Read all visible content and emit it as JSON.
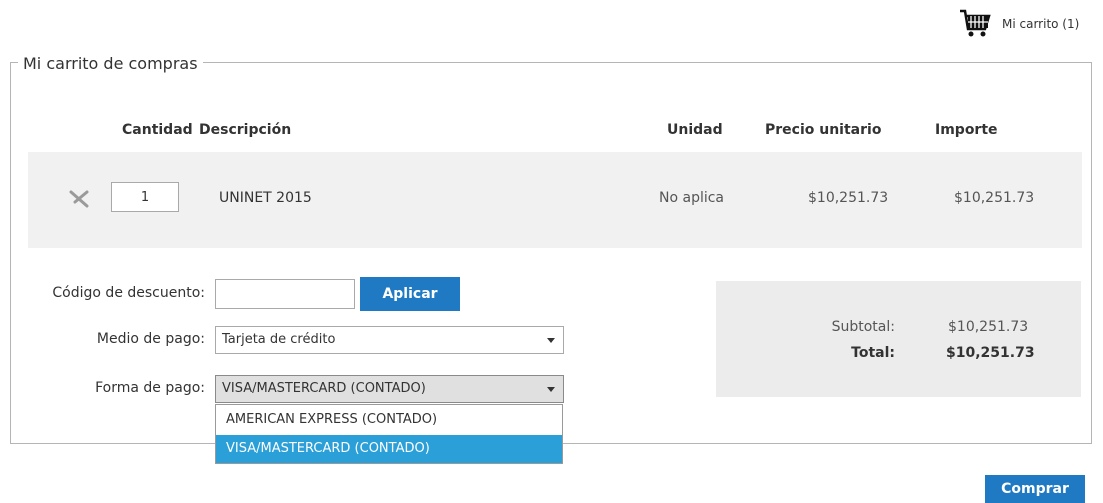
{
  "header": {
    "cart_label": "Mi carrito (1)"
  },
  "cart": {
    "title": "Mi carrito de compras",
    "columns": {
      "quantity": "Cantidad",
      "description": "Descripción",
      "unit": "Unidad",
      "unit_price": "Precio unitario",
      "amount": "Importe"
    },
    "items": [
      {
        "quantity": "1",
        "description": "UNINET 2015",
        "unit": "No aplica",
        "unit_price": "$10,251.73",
        "amount": "$10,251.73"
      }
    ]
  },
  "form": {
    "discount_label": "Código de descuento:",
    "discount_value": "",
    "apply_label": "Aplicar",
    "payment_method_label": "Medio de pago:",
    "payment_method_value": "Tarjeta de crédito",
    "payment_form_label": "Forma de pago:",
    "payment_form_value": "VISA/MASTERCARD (CONTADO)",
    "payment_form_options": [
      "AMERICAN EXPRESS (CONTADO)",
      "VISA/MASTERCARD (CONTADO)"
    ]
  },
  "totals": {
    "subtotal_label": "Subtotal:",
    "subtotal_value": "$10,251.73",
    "total_label": "Total:",
    "total_value": "$10,251.73"
  },
  "actions": {
    "buy_label": "Comprar"
  },
  "colors": {
    "primary": "#1f7ac3",
    "selected_option": "#2a9fd8"
  },
  "icons": {
    "cart": "shopping-cart-icon",
    "remove": "remove-x-icon",
    "dropdown": "chevron-down-icon"
  }
}
